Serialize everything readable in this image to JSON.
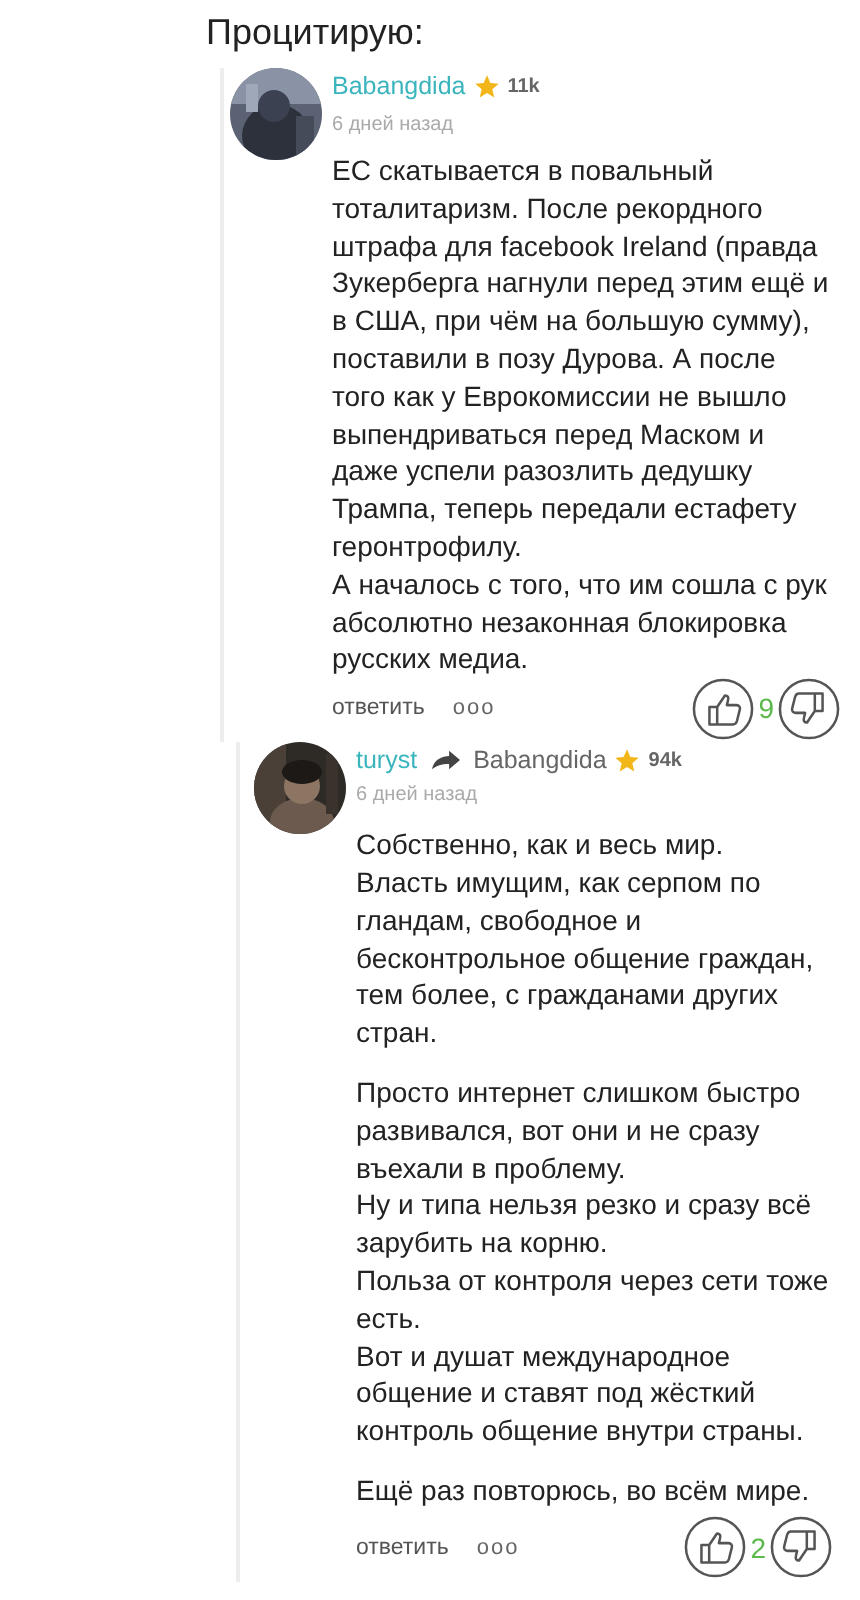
{
  "heading": "Процитирую:",
  "comments": [
    {
      "author": "Babangdida",
      "rating": "11k",
      "time": "6 дней назад",
      "paragraphs": [
        "ЕС скатывается в повальный тоталитаризм. После рекордного штрафа для facebook Ireland (правда Зукерберга нагнули перед этим ещё и в США, при чём на большую сумму), поставили в позу Дурова. А после того как у Еврокомиссии не вышло выпендриваться перед Маском и даже успели разозлить дедушку Трампа, теперь передали естафету геронтрофилу.\nА началось с того, что им сошла с рук абсолютно незаконная блокировка русских медиа."
      ],
      "reply_label": "ответить",
      "more_label": "ooo",
      "votes": "9",
      "children": [
        {
          "author": "turyst",
          "reply_to": "Babangdida",
          "rating": "94k",
          "time": "6 дней назад",
          "paragraphs": [
            "Собственно, как и весь мир.\nВласть имущим, как серпом по гландам, свободное и бесконтрольное общение граждан, тем более, с гражданами других стран.",
            "Просто интернет слишком быстро развивался, вот они и не сразу въехали в проблему.\nНу и типа нельзя резко и сразу всё зарубить на корню.\nПольза от контроля через сети тоже есть.\nВот и душат международное общение и ставят под жёсткий контроль общение внутри страны.",
            "Ещё раз повторюсь, во всём мире."
          ],
          "reply_label": "ответить",
          "more_label": "ooo",
          "votes": "2"
        }
      ]
    }
  ]
}
